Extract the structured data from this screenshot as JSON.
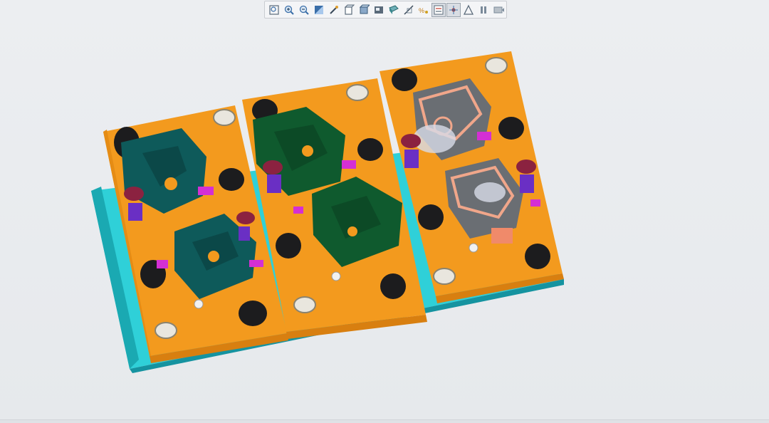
{
  "toolbar": {
    "buttons": [
      {
        "icon": "zoom-fit-icon",
        "active": false
      },
      {
        "icon": "zoom-in-icon",
        "active": false
      },
      {
        "icon": "zoom-out-icon",
        "active": false
      },
      {
        "icon": "refit-icon",
        "active": false
      },
      {
        "icon": "reorient-icon",
        "active": false
      },
      {
        "icon": "saved-views-icon",
        "active": false
      },
      {
        "icon": "display-style-icon",
        "active": false
      },
      {
        "icon": "view-manager-icon",
        "active": false
      },
      {
        "icon": "perspective-icon",
        "active": false
      },
      {
        "icon": "section-icon",
        "active": false
      },
      {
        "icon": "datum-display-icon",
        "active": false
      },
      {
        "icon": "annotation-display-icon",
        "active": true
      },
      {
        "icon": "spin-center-icon",
        "active": true
      },
      {
        "icon": "appearance-icon",
        "active": false
      },
      {
        "icon": "pause-icon",
        "active": false
      },
      {
        "icon": "export-icon",
        "active": false
      }
    ]
  },
  "colors": {
    "plate": "#f39a1e",
    "plate_edge": "#d87f10",
    "base": "#2fd0d8",
    "base_dark": "#1aa9b2",
    "casting_teal": "#0e5a5a",
    "casting_green": "#0f5a2e",
    "casting_grey": "#6a6e73",
    "gasket": "#f0a68a",
    "clamp": "#1c1c1e",
    "magenta": "#d42fd4",
    "purple": "#6a2fc4",
    "disc": "#8b2240",
    "locator": "#e9e6de"
  }
}
